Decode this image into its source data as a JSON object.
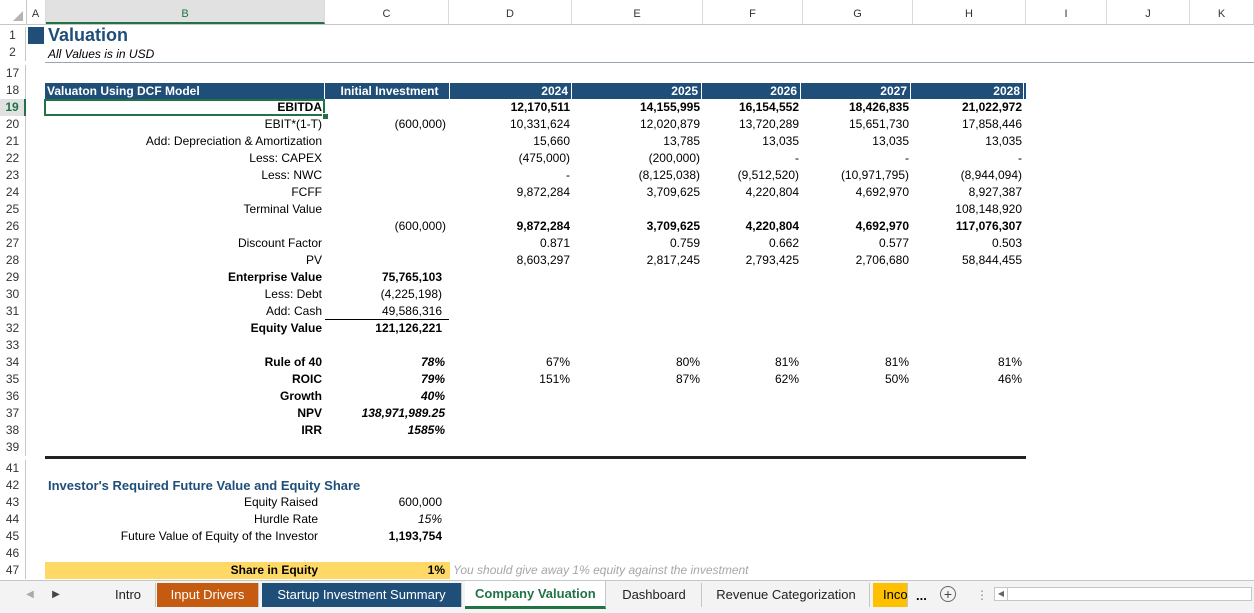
{
  "columns": [
    "A",
    "B",
    "C",
    "D",
    "E",
    "F",
    "G",
    "H",
    "I",
    "J",
    "K"
  ],
  "rows": [
    "1",
    "2",
    "17",
    "18",
    "19",
    "20",
    "21",
    "22",
    "23",
    "24",
    "25",
    "26",
    "27",
    "28",
    "29",
    "30",
    "31",
    "32",
    "33",
    "34",
    "35",
    "36",
    "37",
    "38",
    "39",
    "41",
    "42",
    "43",
    "44",
    "45",
    "46",
    "47"
  ],
  "title": "Valuation",
  "subtitle": "All Values is in USD",
  "table_header": {
    "label": "Valuaton Using DCF Model",
    "initial": "Initial Investment",
    "years": [
      "2024",
      "2025",
      "2026",
      "2027",
      "2028"
    ]
  },
  "dcf_rows": [
    {
      "label": "EBITDA",
      "init": "",
      "vals": [
        "12,170,511",
        "14,155,995",
        "16,154,552",
        "18,426,835",
        "21,022,972"
      ],
      "bold": true
    },
    {
      "label": "EBIT*(1-T)",
      "init": "(600,000)",
      "vals": [
        "10,331,624",
        "12,020,879",
        "13,720,289",
        "15,651,730",
        "17,858,446"
      ],
      "bold": false
    },
    {
      "label": "Add: Depreciation & Amortization",
      "init": "",
      "vals": [
        "15,660",
        "13,785",
        "13,035",
        "13,035",
        "13,035"
      ],
      "bold": false
    },
    {
      "label": "Less: CAPEX",
      "init": "",
      "vals": [
        "(475,000)",
        "(200,000)",
        "-",
        "-",
        "-"
      ],
      "bold": false
    },
    {
      "label": "Less: NWC",
      "init": "",
      "vals": [
        "-",
        "(8,125,038)",
        "(9,512,520)",
        "(10,971,795)",
        "(8,944,094)"
      ],
      "bold": false
    },
    {
      "label": "FCFF",
      "init": "",
      "vals": [
        "9,872,284",
        "3,709,625",
        "4,220,804",
        "4,692,970",
        "8,927,387"
      ],
      "bold": false
    },
    {
      "label": "Terminal Value",
      "init": "",
      "vals": [
        "",
        "",
        "",
        "",
        "108,148,920"
      ],
      "bold": false
    },
    {
      "label": "",
      "init": "(600,000)",
      "vals": [
        "9,872,284",
        "3,709,625",
        "4,220,804",
        "4,692,970",
        "117,076,307"
      ],
      "bold": true
    },
    {
      "label": "Discount Factor",
      "init": "",
      "vals": [
        "0.871",
        "0.759",
        "0.662",
        "0.577",
        "0.503"
      ],
      "bold": false
    },
    {
      "label": "PV",
      "init": "",
      "vals": [
        "8,603,297",
        "2,817,245",
        "2,793,425",
        "2,706,680",
        "58,844,455"
      ],
      "bold": false
    }
  ],
  "equity_rows": [
    {
      "label": "Enterprise Value",
      "value": "75,765,103",
      "bold": true
    },
    {
      "label": "Less: Debt",
      "value": "(4,225,198)",
      "bold": false
    },
    {
      "label": "Add: Cash",
      "value": "49,586,316",
      "bold": false
    },
    {
      "label": "Equity Value",
      "value": "121,126,221",
      "bold": true
    }
  ],
  "metrics": [
    {
      "label": "Rule of 40",
      "init": "78%",
      "vals": [
        "67%",
        "80%",
        "81%",
        "81%",
        "81%"
      ]
    },
    {
      "label": "ROIC",
      "init": "79%",
      "vals": [
        "151%",
        "87%",
        "62%",
        "50%",
        "46%"
      ]
    },
    {
      "label": "Growth",
      "init": "40%",
      "vals": []
    },
    {
      "label": "NPV",
      "init": "138,971,989.25",
      "vals": []
    },
    {
      "label": "IRR",
      "init": "1585%",
      "vals": []
    }
  ],
  "investor": {
    "heading": "Investor's Required Future Value and Equity Share",
    "rows": [
      {
        "label": "Equity Raised",
        "value": "600,000",
        "style": ""
      },
      {
        "label": "Hurdle Rate",
        "value": "15%",
        "style": "i"
      },
      {
        "label": "Future Value of Equity of the Investor",
        "value": "1,193,754",
        "style": "b"
      }
    ],
    "share_label": "Share in Equity",
    "share_value": "1%",
    "share_note": "You should give away 1% equity against the investment"
  },
  "sheet_tabs": [
    "Intro",
    "Input Drivers",
    "Startup Investment Summary",
    "Company Valuation",
    "Dashboard",
    "Revenue Categorization",
    "Inco"
  ],
  "active_tab": "Company Valuation",
  "tab_more": "...",
  "colors": {
    "header_bg": "#1f4e79",
    "accent_green": "#217346",
    "tab_orange": "#c55a11",
    "tab_blue": "#1f4e79",
    "tab_gold": "#ffc000",
    "share_bg": "#ffd966"
  }
}
